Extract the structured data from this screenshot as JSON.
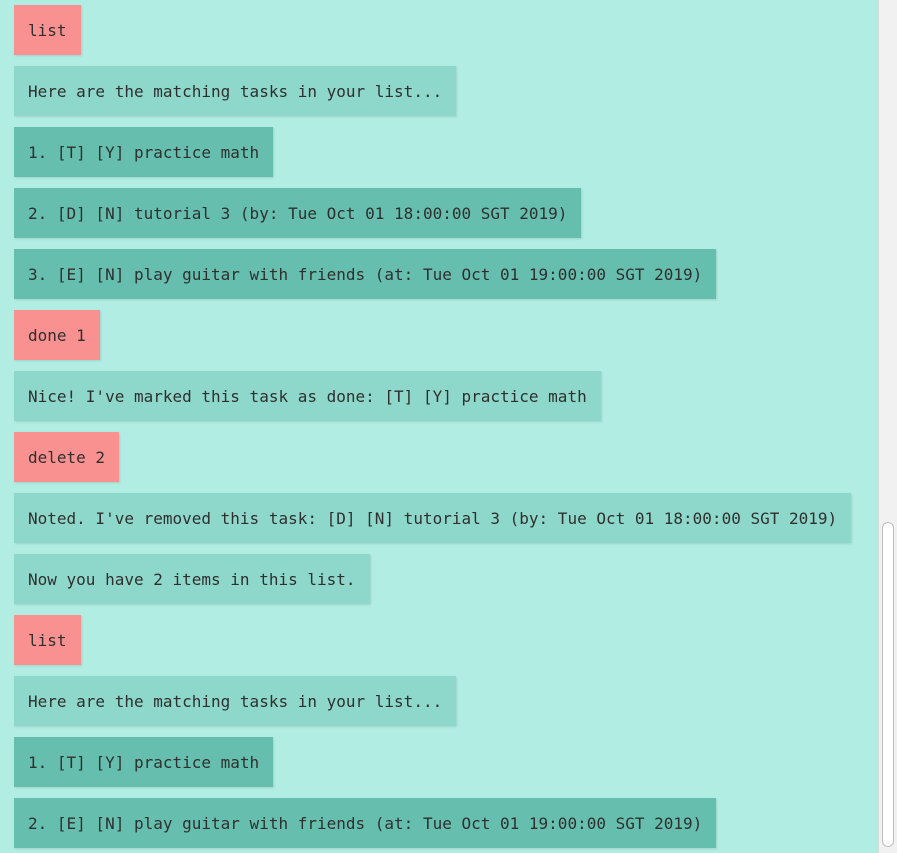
{
  "window": {
    "title": ""
  },
  "messages": [
    {
      "kind": "user",
      "text": "list"
    },
    {
      "kind": "info",
      "text": "Here are the matching tasks in your list..."
    },
    {
      "kind": "task",
      "text": "1. [T] [Y] practice math"
    },
    {
      "kind": "task",
      "text": "2. [D] [N] tutorial 3 (by: Tue Oct 01 18:00:00 SGT 2019)"
    },
    {
      "kind": "task",
      "text": "3. [E] [N] play guitar with friends (at: Tue Oct 01 19:00:00 SGT 2019)"
    },
    {
      "kind": "user",
      "text": "done 1"
    },
    {
      "kind": "info",
      "text": "Nice! I've marked this task as done: [T] [Y] practice math"
    },
    {
      "kind": "user",
      "text": "delete 2"
    },
    {
      "kind": "info",
      "text": "Noted. I've removed this task: [D] [N] tutorial 3 (by: Tue Oct 01 18:00:00 SGT 2019)"
    },
    {
      "kind": "info",
      "text": "Now you have 2 items in this list."
    },
    {
      "kind": "user",
      "text": "list"
    },
    {
      "kind": "info",
      "text": "Here are the matching tasks in your list..."
    },
    {
      "kind": "task",
      "text": "1. [T] [Y] practice math"
    },
    {
      "kind": "task",
      "text": "2. [E] [N] play guitar with friends (at: Tue Oct 01 19:00:00 SGT 2019)"
    }
  ],
  "colors": {
    "background": "#b2ede4",
    "user_bubble": "#fa9191",
    "info_bubble": "#8ed8cb",
    "task_bubble": "#66bfae"
  }
}
